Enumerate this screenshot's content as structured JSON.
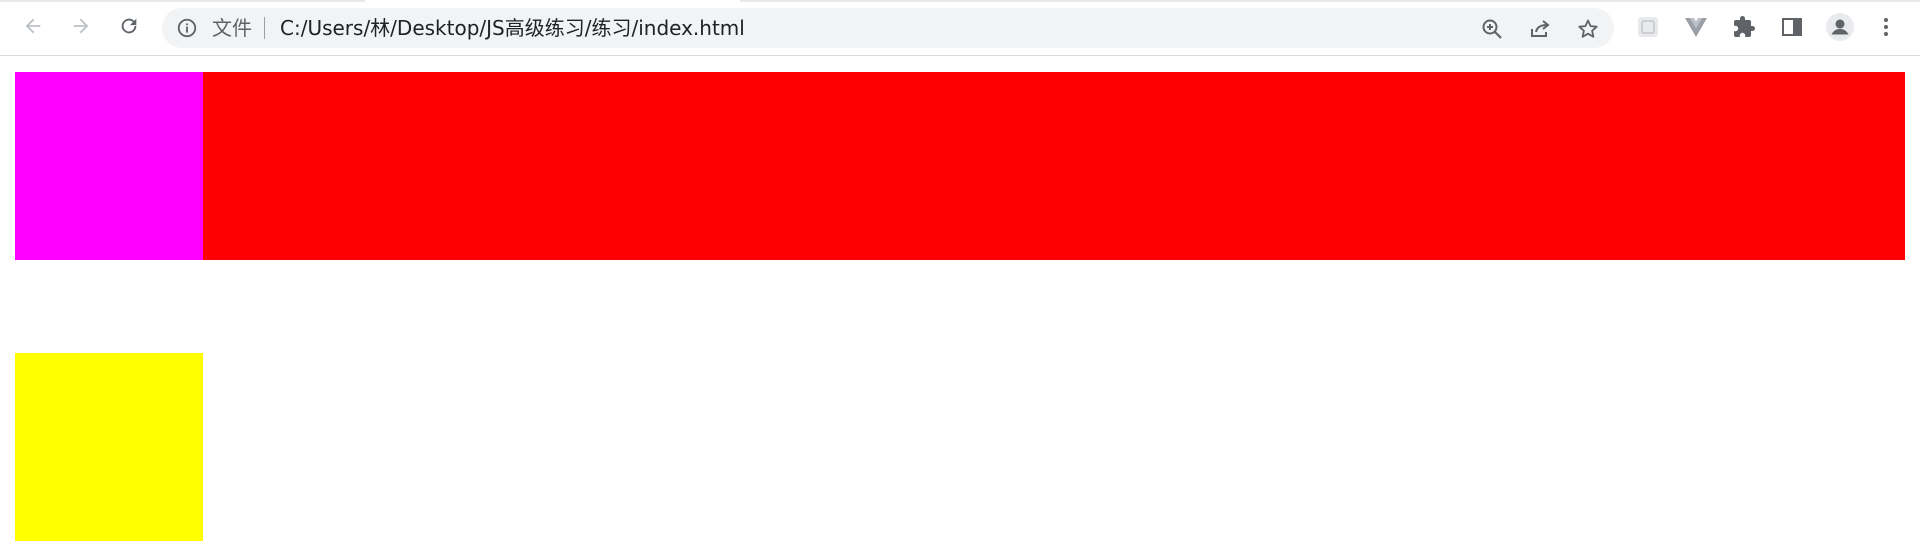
{
  "browser": {
    "address_bar": {
      "scheme_label": "文件",
      "url": "C:/Users/林/Desktop/JS高级练习/练习/index.html"
    },
    "icons": {
      "back": "arrow-left-icon",
      "forward": "arrow-right-icon",
      "reload": "reload-icon",
      "info": "info-icon",
      "zoom": "zoom-in-icon",
      "share": "share-icon",
      "bookmark": "star-icon",
      "extension_a": "extension-icon",
      "extension_b": "vue-devtools-icon",
      "extensions": "puzzle-icon",
      "side_panel": "side-panel-icon",
      "profile": "avatar-icon",
      "menu": "kebab-menu-icon"
    }
  },
  "page": {
    "boxes": [
      {
        "name": "red-bar",
        "color": "#ff0000"
      },
      {
        "name": "magenta-box",
        "color": "#ff00ff"
      },
      {
        "name": "yellow-box",
        "color": "#ffff00"
      }
    ]
  }
}
